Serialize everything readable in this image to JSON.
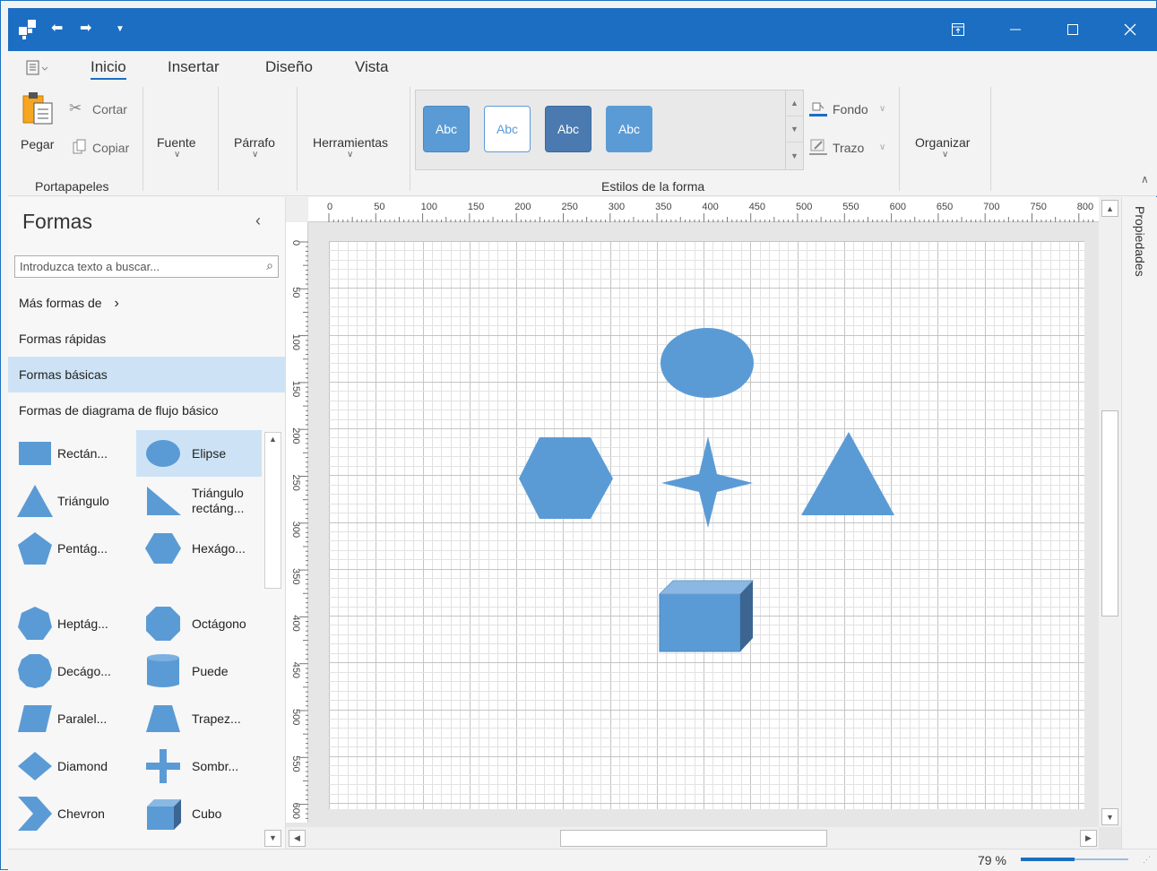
{
  "ribbon": {
    "tabs": [
      "Inicio",
      "Insertar",
      "Diseño",
      "Vista"
    ],
    "active_tab": "Inicio",
    "clipboard": {
      "paste": "Pegar",
      "cut": "Cortar",
      "copy": "Copiar",
      "group": "Portapapeles"
    },
    "font": "Fuente",
    "paragraph": "Párrafo",
    "tools": "Herramientas",
    "styles": {
      "group": "Estilos de la forma",
      "sample": "Abc"
    },
    "fill": "Fondo",
    "stroke": "Trazo",
    "arrange": "Organizar",
    "accent_color": "#1b6ec2"
  },
  "shapes_panel": {
    "title": "Formas",
    "search_placeholder": "Introduzca texto a buscar...",
    "categories": [
      "Más formas de",
      "Formas rápidas",
      "Formas básicas",
      "Formas de diagrama de flujo básico"
    ],
    "active_category": "Formas básicas",
    "shapes": [
      {
        "label": "Rectán...",
        "icon": "rectangle-icon"
      },
      {
        "label": "Elipse",
        "icon": "ellipse-icon",
        "selected": true
      },
      {
        "label": "Triángulo",
        "icon": "triangle-icon"
      },
      {
        "label": "Triángulo rectáng...",
        "icon": "right-triangle-icon"
      },
      {
        "label": "Pentág...",
        "icon": "pentagon-icon"
      },
      {
        "label": "Hexágo...",
        "icon": "hexagon-icon"
      },
      {
        "label": "Heptág...",
        "icon": "heptagon-icon"
      },
      {
        "label": "Octágono",
        "icon": "octagon-icon"
      },
      {
        "label": "Decágo...",
        "icon": "decagon-icon"
      },
      {
        "label": "Puede",
        "icon": "can-icon"
      },
      {
        "label": "Paralel...",
        "icon": "parallelogram-icon"
      },
      {
        "label": "Trapez...",
        "icon": "trapezoid-icon"
      },
      {
        "label": "Diamond",
        "icon": "diamond-icon"
      },
      {
        "label": "Sombr...",
        "icon": "plus-icon"
      },
      {
        "label": "Chevron",
        "icon": "chevron-icon"
      },
      {
        "label": "Cubo",
        "icon": "cube-icon"
      }
    ]
  },
  "ruler": {
    "h_ticks": [
      "0",
      "50",
      "100",
      "150",
      "200",
      "250",
      "300",
      "350",
      "400",
      "450",
      "500",
      "550",
      "600",
      "650",
      "700",
      "750",
      "800"
    ],
    "v_ticks": [
      "0",
      "50",
      "100",
      "150",
      "200",
      "250",
      "300",
      "350",
      "400",
      "450",
      "500",
      "550",
      "600"
    ]
  },
  "canvas": {
    "shape_color": "#5b9bd5",
    "shapes": [
      "ellipse",
      "hexagon",
      "four-point-star",
      "triangle",
      "cube"
    ]
  },
  "right_panel": {
    "label": "Propiedades"
  },
  "status": {
    "zoom": "79 %",
    "zoom_fraction": 0.5
  }
}
